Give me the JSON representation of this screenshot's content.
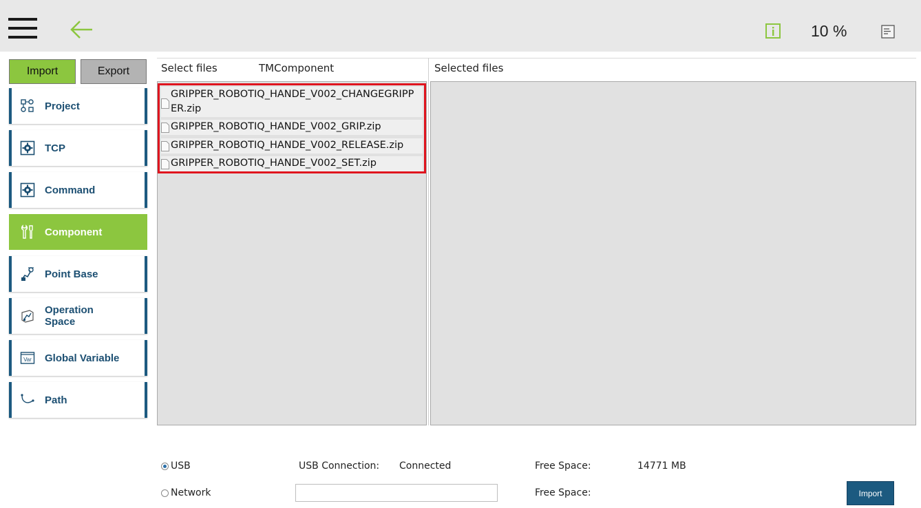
{
  "topbar": {
    "zoom": "10 %",
    "icons": [
      "menu-icon",
      "back-arrow-icon",
      "info-icon",
      "log-icon"
    ],
    "colors": {
      "accent": "#8cc63f",
      "brand": "#1c5a80"
    }
  },
  "sidebar": {
    "tabs": {
      "import": "Import",
      "export": "Export"
    },
    "items": [
      {
        "label": "Project",
        "icon": "project-icon"
      },
      {
        "label": "TCP",
        "icon": "gear-box-icon"
      },
      {
        "label": "Command",
        "icon": "gear-box-icon"
      },
      {
        "label": "Component",
        "icon": "component-icon",
        "active": true
      },
      {
        "label": "Point Base",
        "icon": "point-base-icon"
      },
      {
        "label": "Operation\nSpace",
        "icon": "operation-space-icon"
      },
      {
        "label": "Global Variable",
        "icon": "var-icon"
      },
      {
        "label": "Path",
        "icon": "path-icon"
      }
    ]
  },
  "files": {
    "select_label": "Select files",
    "folder": "TMComponent",
    "selected_label": "Selected files",
    "items": [
      "GRIPPER_ROBOTIQ_HANDE_V002_CHANGEGRIPPER.zip",
      "GRIPPER_ROBOTIQ_HANDE_V002_GRIP.zip",
      "GRIPPER_ROBOTIQ_HANDE_V002_RELEASE.zip",
      "GRIPPER_ROBOTIQ_HANDE_V002_SET.zip"
    ]
  },
  "bottom": {
    "usb_label": "USB",
    "network_label": "Network",
    "usb_connection_label": "USB Connection:",
    "usb_connection_value": "Connected",
    "free_space_label": "Free Space:",
    "usb_free_space": "14771 MB",
    "network_free_space_label": "Free Space:",
    "network_path_value": "",
    "import_button": "Import"
  }
}
